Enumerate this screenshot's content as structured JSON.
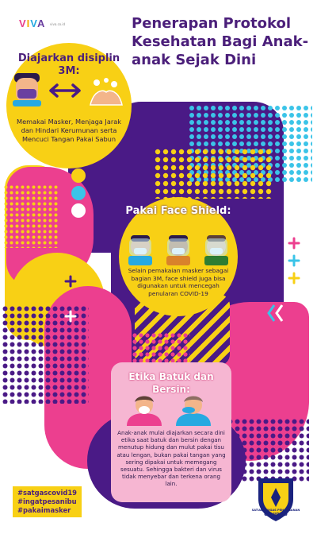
{
  "logo": {
    "brand_v": "V",
    "brand_i": "I",
    "brand_v2": "V",
    "brand_a": "A",
    "sub": "viva.co.id"
  },
  "title": "Penerapan Protokol Kesehatan Bagi Anak-anak Sejak Dini",
  "section1": {
    "title": "Diajarkan disiplin 3M:",
    "text": "Memakai Masker, Menjaga Jarak dan Hindari Kerumunan serta Mencuci Tangan Pakai Sabun"
  },
  "section2": {
    "title": "Pakai Face Shield:",
    "text": "Selain pemakaian masker sebagai bagian 3M, face shield juga bisa digunakan untuk mencegah penularan COVID-19"
  },
  "section3": {
    "title": "Etika Batuk dan Bersin:",
    "text": "Anak-anak mulai diajarkan secara dini etika saat batuk dan bersin dengan menutup hidung dan mulut pakai tisu atau lengan, bukan pakai tangan yang sering dipakai untuk memegang sesuatu. Sehingga bakteri dan virus tidak menyebar dan terkena orang lain."
  },
  "hashtags": [
    "#satgascovid19",
    "#ingatpesanibu",
    "#pakaimasker"
  ],
  "footer": {
    "org_small": "SATUAN TUGAS PENANGANAN",
    "org_big": "COVID-19"
  },
  "colors": {
    "purple": "#4a1a86",
    "pink": "#ec3f8f",
    "yellow": "#f8d015",
    "cyan": "#3bc4e8",
    "title": "#4b1f7a"
  }
}
